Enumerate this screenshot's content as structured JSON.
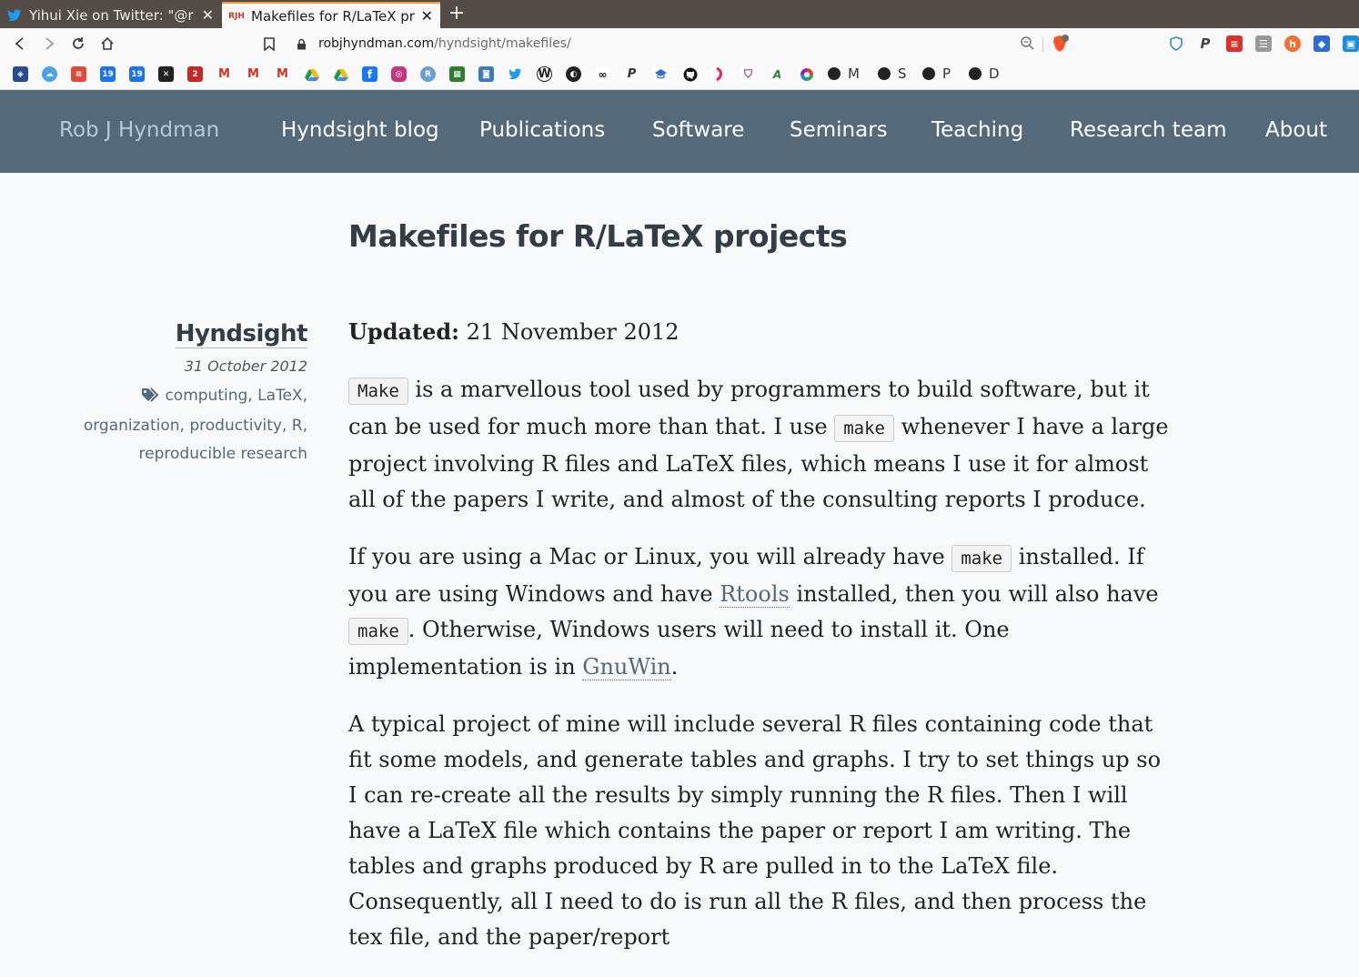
{
  "browser": {
    "tabs": [
      {
        "title": "Yihui Xie on Twitter: \"@r",
        "favicon": "twitter-bird-icon",
        "active": false
      },
      {
        "title": "Makefiles for R/LaTeX pr",
        "favicon": "rjh-favicon",
        "favicon_text": "RJH",
        "active": true
      }
    ],
    "url": {
      "host": "robjhyndman.com",
      "path": "/hyndsight/makefiles/"
    },
    "bookmarks_text": [
      "M",
      "S",
      "P",
      "D"
    ]
  },
  "site": {
    "brand": "Rob J Hyndman",
    "nav": [
      "Hyndsight blog",
      "Publications",
      "Software",
      "Seminars",
      "Teaching",
      "Research team",
      "About"
    ],
    "colors": {
      "header_bg": "#546a7b",
      "brand": "#b5c9d9",
      "link": "#546a7b"
    }
  },
  "article": {
    "title": "Makefiles for R/LaTeX projects",
    "sidebar": {
      "section": "Hyndsight",
      "date": "31 October 2012",
      "tags": [
        "computing",
        "LaTeX",
        "organization",
        "productivity",
        "R",
        "reproducible research"
      ]
    },
    "updated_label": "Updated:",
    "updated_date": "21 November 2012",
    "p1": {
      "code1": "Make",
      "t1": " is a marvellous tool used by programmers to build software, but it can be used for much more than that. I use ",
      "code2": "make",
      "t2": " whenever I have a large project involving R files and LaTeX files, which means I use it for almost all of the papers I write, and almost of the consulting reports I produce."
    },
    "p2": {
      "t1": "If you are using a Mac or Linux, you will already have ",
      "code1": "make",
      "t2": " installed. If you are using Windows and have ",
      "link1": "Rtools",
      "t3": " installed, then you will also have ",
      "code2": "make",
      "t4": ". Otherwise, Windows users will need to install it. One implementation is in ",
      "link2": "GnuWin",
      "t5": "."
    },
    "p3": "A typical project of mine will include several R files containing code that fit some models, and generate tables and graphs. I try to set things up so I can re-create all the results by simply running the R files. Then I will have a LaTeX file which contains the paper or report I am writing. The tables and graphs produced by R are pulled in to the LaTeX file. Consequently, all I need to do is run all the R files, and then process the tex file, and the paper/report"
  }
}
